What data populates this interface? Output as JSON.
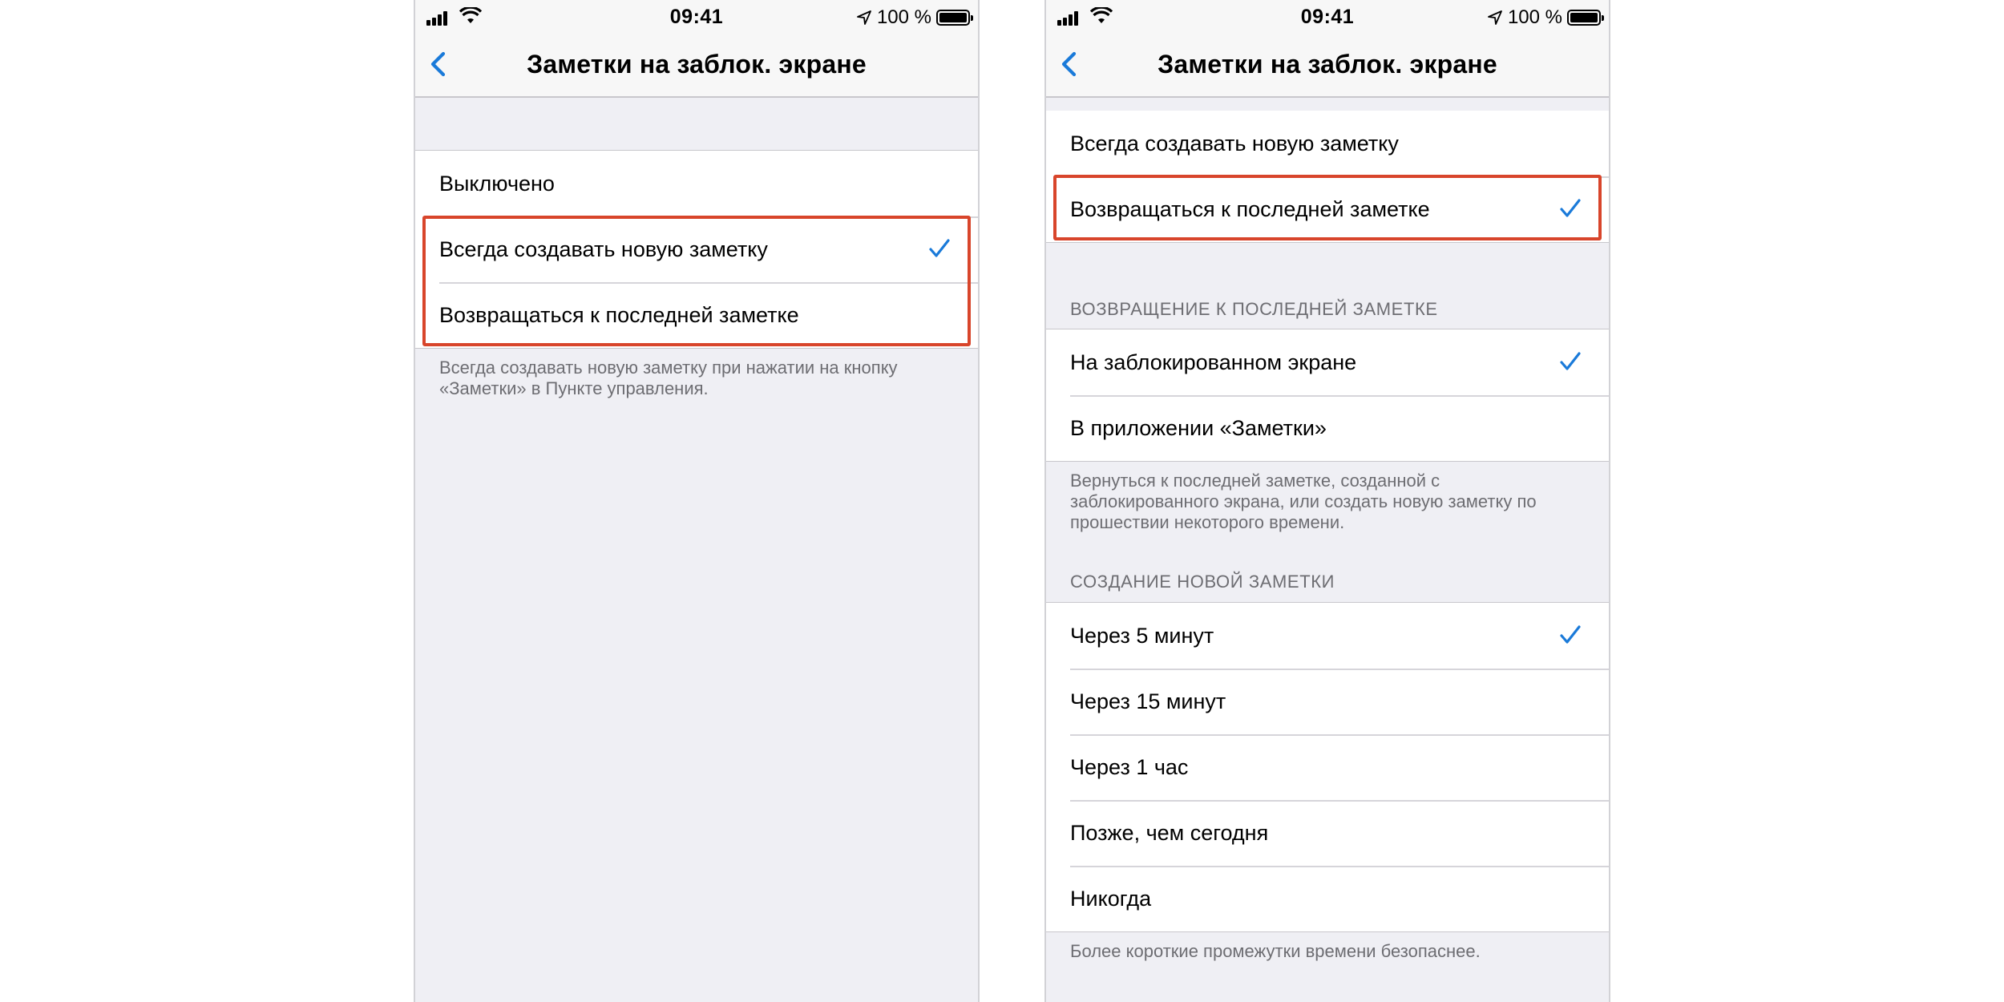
{
  "accent_color": "#1a7ad9",
  "highlight_color": "#d8452b",
  "status_bar": {
    "time": "09:41",
    "battery_text": "100 %"
  },
  "screens": [
    {
      "nav_title": "Заметки на заблок. экране",
      "options": [
        {
          "label": "Выключено",
          "checked": false
        },
        {
          "label": "Всегда создавать новую заметку",
          "checked": true
        },
        {
          "label": "Возвращаться к последней заметке",
          "checked": false
        }
      ],
      "footer": "Всегда создавать новую заметку при нажатии на кнопку «Заметки» в Пункте управления."
    },
    {
      "nav_title": "Заметки на заблок. экране",
      "options": [
        {
          "label": "Всегда создавать новую заметку",
          "checked": false
        },
        {
          "label": "Возвращаться к последней заметке",
          "checked": true
        }
      ],
      "return_section": {
        "header": "ВОЗВРАЩЕНИЕ К ПОСЛЕДНЕЙ ЗАМЕТКЕ",
        "options": [
          {
            "label": "На заблокированном экране",
            "checked": true
          },
          {
            "label": "В приложении «Заметки»",
            "checked": false
          }
        ],
        "footer": "Вернуться к последней заметке, созданной с заблокированного экрана, или создать новую заметку по прошествии некоторого времени."
      },
      "new_note_section": {
        "header": "СОЗДАНИЕ НОВОЙ ЗАМЕТКИ",
        "options": [
          {
            "label": "Через 5 минут",
            "checked": true
          },
          {
            "label": "Через 15 минут",
            "checked": false
          },
          {
            "label": "Через 1 час",
            "checked": false
          },
          {
            "label": "Позже, чем сегодня",
            "checked": false
          },
          {
            "label": "Никогда",
            "checked": false
          }
        ],
        "footer": "Более короткие промежутки времени безопаснее."
      }
    }
  ]
}
